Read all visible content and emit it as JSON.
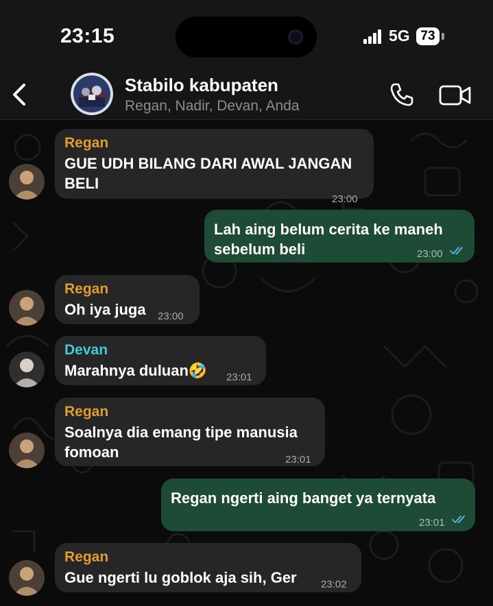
{
  "status_bar": {
    "time": "23:15",
    "network": "5G",
    "battery": "73"
  },
  "header": {
    "group_name": "Stabilo kabupaten",
    "members": "Regan, Nadir, Devan, Anda"
  },
  "messages": [
    {
      "direction": "incoming",
      "sender": "Regan",
      "lines": [
        "GUE UDH BILANG DARI AWAL JANGAN",
        "BELI"
      ],
      "time": "23:00"
    },
    {
      "direction": "outgoing",
      "lines": [
        "Lah aing belum cerita ke maneh",
        "sebelum beli"
      ],
      "time": "23:00",
      "read": true
    },
    {
      "direction": "incoming",
      "sender": "Regan",
      "lines": [
        "Oh iya juga"
      ],
      "time": "23:00"
    },
    {
      "direction": "incoming",
      "sender": "Devan",
      "lines": [
        "Marahnya duluan🤣"
      ],
      "time": "23:01"
    },
    {
      "direction": "incoming",
      "sender": "Regan",
      "lines": [
        "Soalnya dia emang tipe manusia",
        "fomoan"
      ],
      "time": "23:01"
    },
    {
      "direction": "outgoing",
      "lines": [
        "Regan ngerti aing banget ya ternyata"
      ],
      "time": "23:01",
      "read": true
    },
    {
      "direction": "incoming",
      "sender": "Regan",
      "lines": [
        "Gue ngerti lu goblok aja sih, Ger"
      ],
      "time": "23:02"
    }
  ],
  "colors": {
    "incoming_bubble": "#262626",
    "outgoing_bubble": "#1d4b36",
    "sender_regan": "#e19c32",
    "sender_devan": "#46c9d6",
    "read_ticks": "#53bdeb"
  },
  "icons": {
    "back": "chevron-left-icon",
    "call": "phone-icon",
    "video": "video-camera-icon",
    "read_receipt": "double-check-icon"
  }
}
